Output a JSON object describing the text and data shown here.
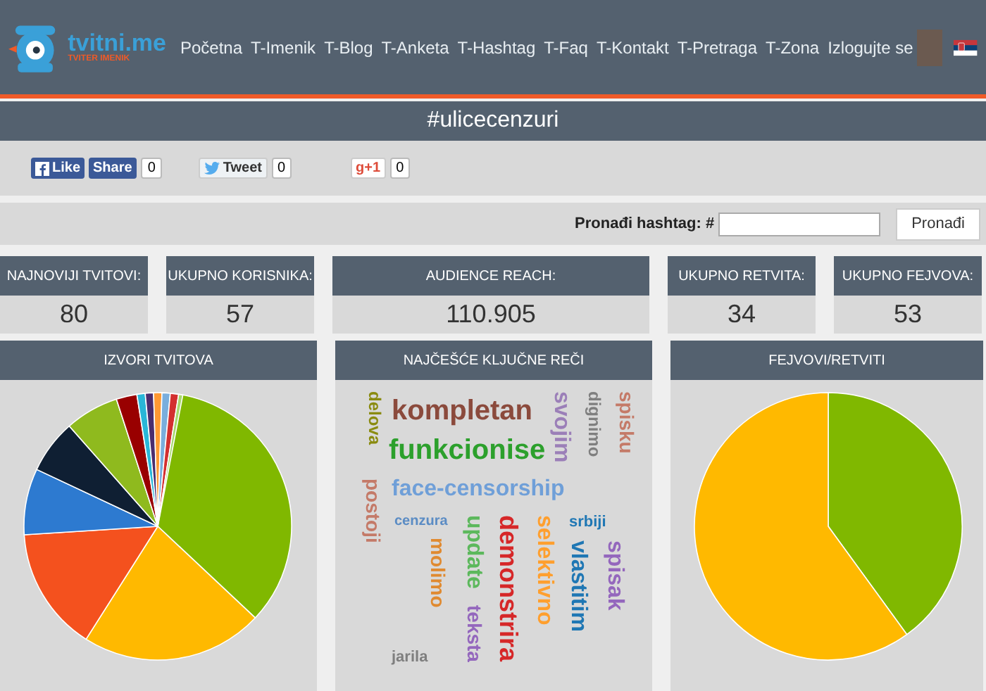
{
  "logo": {
    "name": "tvitni.me",
    "tagline": "TVITER IMENIK"
  },
  "nav": [
    "Početna",
    "T-Imenik",
    "T-Blog",
    "T-Anketa",
    "T-Hashtag",
    "T-Faq",
    "T-Kontakt",
    "T-Pretraga",
    "T-Zona",
    "Izlogujte se"
  ],
  "page_title": "#ulicecenzuri",
  "share": {
    "facebook_like": "Like",
    "facebook_share": "Share",
    "facebook_count": "0",
    "tweet": "Tweet",
    "tweet_count": "0",
    "gplus": "g+1",
    "gplus_count": "0"
  },
  "search": {
    "label": "Pronađi hashtag: #",
    "button": "Pronađi"
  },
  "stats": [
    {
      "label": "NAJNOVIJI TVITOVI:",
      "value": "80"
    },
    {
      "label": "UKUPNO KORISNIKA:",
      "value": "57"
    },
    {
      "label": "AUDIENCE REACH:",
      "value": "110.905"
    },
    {
      "label": "UKUPNO RETVITA:",
      "value": "34"
    },
    {
      "label": "UKUPNO FEJVOVA:",
      "value": "53"
    }
  ],
  "panels": [
    {
      "title": "IZVORI TVITOVA"
    },
    {
      "title": "NAJČEŠĆE KLJUČNE REČI"
    },
    {
      "title": "FEJVOVI/RETVITI"
    }
  ],
  "word_cloud": [
    {
      "text": "delova",
      "color": "#8a8b10",
      "vertical": true
    },
    {
      "text": "kompletan",
      "color": "#8b4a3c",
      "vertical": false
    },
    {
      "text": "svojim",
      "color": "#9b7fb8",
      "vertical": true
    },
    {
      "text": "dignimo",
      "color": "#7f7f7f",
      "vertical": true
    },
    {
      "text": "spisku",
      "color": "#c47a68",
      "vertical": true
    },
    {
      "text": "funkcionise",
      "color": "#2ca02c",
      "vertical": false
    },
    {
      "text": "postoji",
      "color": "#c47a68",
      "vertical": true
    },
    {
      "text": "face-censorship",
      "color": "#6f9fd8",
      "vertical": false
    },
    {
      "text": "cenzura",
      "color": "#5b8cc4",
      "vertical": false
    },
    {
      "text": "update",
      "color": "#5cb85c",
      "vertical": true
    },
    {
      "text": "demonstrira",
      "color": "#d62728",
      "vertical": true
    },
    {
      "text": "selektivno",
      "color": "#ff9f2e",
      "vertical": true
    },
    {
      "text": "srbiji",
      "color": "#1f77b4",
      "vertical": false
    },
    {
      "text": "molimo",
      "color": "#e08a30",
      "vertical": true
    },
    {
      "text": "vlastitim",
      "color": "#1f77b4",
      "vertical": true
    },
    {
      "text": "spisak",
      "color": "#9467bd",
      "vertical": true
    },
    {
      "text": "teksta",
      "color": "#9467bd",
      "vertical": true
    },
    {
      "text": "jarila",
      "color": "#7f7f7f",
      "vertical": false
    }
  ]
}
